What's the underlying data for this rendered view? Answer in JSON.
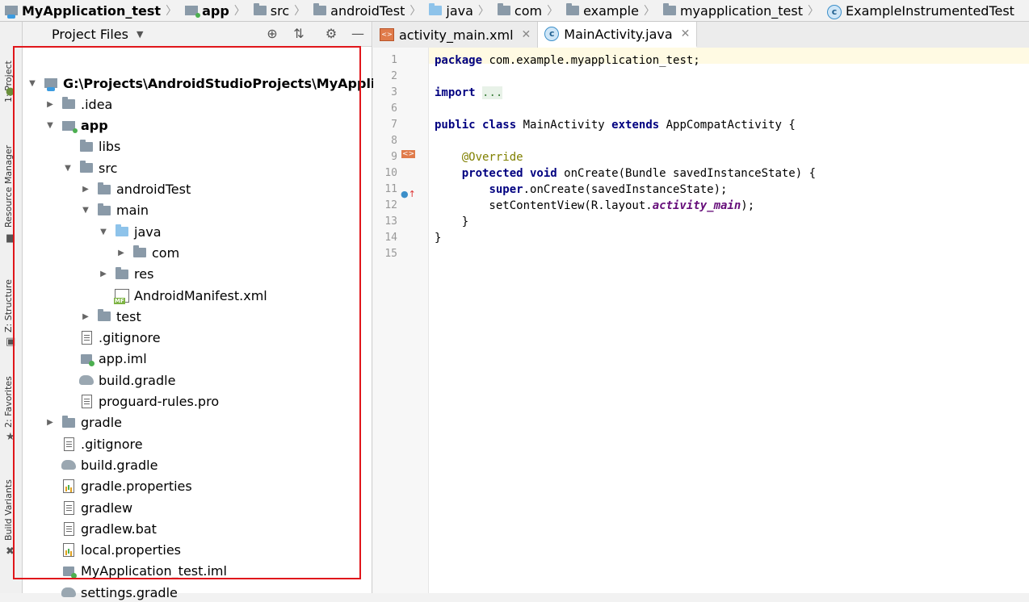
{
  "breadcrumbs": [
    {
      "label": "MyApplication_test",
      "icon": "project-folder-icon",
      "bold": true
    },
    {
      "label": "app",
      "icon": "module-folder-icon",
      "bold": true
    },
    {
      "label": "src",
      "icon": "folder-icon",
      "bold": false
    },
    {
      "label": "androidTest",
      "icon": "folder-icon",
      "bold": false
    },
    {
      "label": "java",
      "icon": "source-folder-icon",
      "bold": false
    },
    {
      "label": "com",
      "icon": "package-icon",
      "bold": false
    },
    {
      "label": "example",
      "icon": "package-icon",
      "bold": false
    },
    {
      "label": "myapplication_test",
      "icon": "package-icon",
      "bold": false
    },
    {
      "label": "ExampleInstrumentedTest",
      "icon": "class-icon",
      "bold": false
    }
  ],
  "tool_strip": {
    "project": "1: Project",
    "resource_manager": "Resource Manager",
    "structure": "Z: Structure",
    "favorites": "2: Favorites",
    "build_variants": "Build Variants"
  },
  "project_panel": {
    "title": "Project Files",
    "tree": [
      {
        "label": "G:\\Projects\\AndroidStudioProjects\\MyApplicat",
        "icon": "project-folder-icon",
        "arrow": "expanded",
        "bold": true
      },
      {
        "label": ".idea",
        "icon": "folder-icon",
        "arrow": "collapsed",
        "bold": false
      },
      {
        "label": "app",
        "icon": "module-folder-icon",
        "arrow": "expanded",
        "bold": true
      },
      {
        "label": "libs",
        "icon": "folder-icon",
        "arrow": "none",
        "bold": false
      },
      {
        "label": "src",
        "icon": "folder-icon",
        "arrow": "expanded",
        "bold": false
      },
      {
        "label": "androidTest",
        "icon": "folder-icon",
        "arrow": "collapsed",
        "bold": false
      },
      {
        "label": "main",
        "icon": "folder-icon",
        "arrow": "expanded",
        "bold": false
      },
      {
        "label": "java",
        "icon": "source-folder-icon",
        "arrow": "expanded",
        "bold": false
      },
      {
        "label": "com",
        "icon": "package-icon",
        "arrow": "collapsed",
        "bold": false
      },
      {
        "label": "res",
        "icon": "resource-folder-icon",
        "arrow": "collapsed",
        "bold": false
      },
      {
        "label": "AndroidManifest.xml",
        "icon": "manifest-file-icon",
        "arrow": "none",
        "bold": false
      },
      {
        "label": "test",
        "icon": "folder-icon",
        "arrow": "collapsed",
        "bold": false
      },
      {
        "label": ".gitignore",
        "icon": "text-file-icon",
        "arrow": "none",
        "bold": false
      },
      {
        "label": "app.iml",
        "icon": "iml-file-icon",
        "arrow": "none",
        "bold": false
      },
      {
        "label": "build.gradle",
        "icon": "gradle-file-icon",
        "arrow": "none",
        "bold": false
      },
      {
        "label": "proguard-rules.pro",
        "icon": "text-file-icon",
        "arrow": "none",
        "bold": false
      },
      {
        "label": "gradle",
        "icon": "folder-icon",
        "arrow": "collapsed",
        "bold": false
      },
      {
        "label": ".gitignore",
        "icon": "text-file-icon",
        "arrow": "none",
        "bold": false
      },
      {
        "label": "build.gradle",
        "icon": "gradle-file-icon",
        "arrow": "none",
        "bold": false
      },
      {
        "label": "gradle.properties",
        "icon": "properties-file-icon",
        "arrow": "none",
        "bold": false
      },
      {
        "label": "gradlew",
        "icon": "text-file-icon",
        "arrow": "none",
        "bold": false
      },
      {
        "label": "gradlew.bat",
        "icon": "text-file-icon",
        "arrow": "none",
        "bold": false
      },
      {
        "label": "local.properties",
        "icon": "properties-file-icon",
        "arrow": "none",
        "bold": false
      },
      {
        "label": "MyApplication_test.iml",
        "icon": "project-iml-icon",
        "arrow": "none",
        "bold": false
      },
      {
        "label": "settings.gradle",
        "icon": "gradle-file-icon",
        "arrow": "none",
        "bold": false
      }
    ]
  },
  "editor": {
    "tabs": [
      {
        "label": "activity_main.xml",
        "icon": "xml-file-icon",
        "active": false
      },
      {
        "label": "MainActivity.java",
        "icon": "class-icon",
        "active": true
      }
    ],
    "lines": [
      {
        "n": "1",
        "parts": [
          {
            "t": "package",
            "c": "kw"
          },
          {
            "t": " com.example.myapplication_test;",
            "c": ""
          }
        ]
      },
      {
        "n": "2",
        "parts": []
      },
      {
        "n": "3",
        "parts": [
          {
            "t": "import",
            "c": "kw"
          },
          {
            "t": " ",
            "c": ""
          },
          {
            "t": "...",
            "c": "fold"
          }
        ]
      },
      {
        "n": "6",
        "parts": []
      },
      {
        "n": "7",
        "parts": [
          {
            "t": "public class",
            "c": "kw"
          },
          {
            "t": " MainActivity ",
            "c": ""
          },
          {
            "t": "extends",
            "c": "kw"
          },
          {
            "t": " AppCompatActivity {",
            "c": ""
          }
        ]
      },
      {
        "n": "8",
        "parts": []
      },
      {
        "n": "9",
        "parts": [
          {
            "t": "    @Override",
            "c": "ann"
          }
        ]
      },
      {
        "n": "10",
        "parts": [
          {
            "t": "    ",
            "c": ""
          },
          {
            "t": "protected void",
            "c": "kw"
          },
          {
            "t": " onCreate(Bundle savedInstanceState) {",
            "c": ""
          }
        ]
      },
      {
        "n": "11",
        "parts": [
          {
            "t": "        ",
            "c": ""
          },
          {
            "t": "super",
            "c": "kw"
          },
          {
            "t": ".onCreate(savedInstanceState);",
            "c": ""
          }
        ]
      },
      {
        "n": "12",
        "parts": [
          {
            "t": "        setContentView(R.layout.",
            "c": ""
          },
          {
            "t": "activity_main",
            "c": "fld"
          },
          {
            "t": ");",
            "c": ""
          }
        ]
      },
      {
        "n": "13",
        "parts": [
          {
            "t": "    }",
            "c": ""
          }
        ]
      },
      {
        "n": "14",
        "parts": [
          {
            "t": "}",
            "c": ""
          }
        ]
      },
      {
        "n": "15",
        "parts": []
      }
    ]
  },
  "colors": {
    "highlight_box": "#e0161b",
    "keyword": "#000080",
    "annotation": "#808000",
    "field": "#660e7a"
  }
}
